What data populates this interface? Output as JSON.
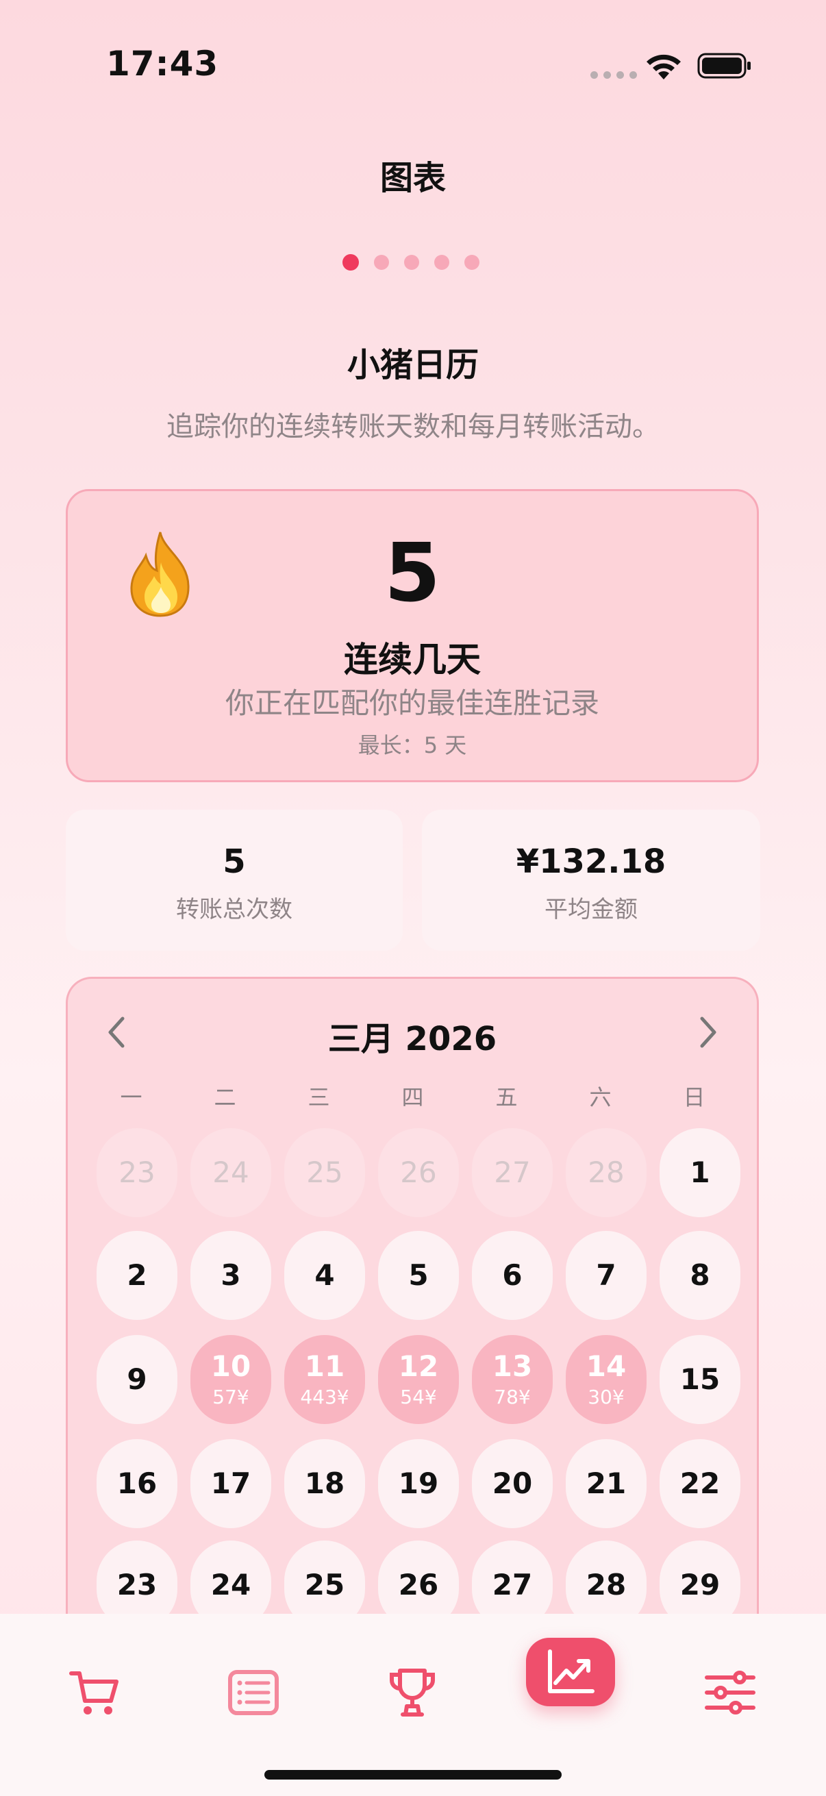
{
  "status": {
    "time": "17:43"
  },
  "nav": {
    "title": "图表"
  },
  "pager": {
    "count": 5,
    "active_index": 0
  },
  "section": {
    "title": "小猪日历",
    "subtitle": "追踪你的连续转账天数和每月转账活动。"
  },
  "streak": {
    "value": "5",
    "label": "连续几天",
    "message": "你正在匹配你的最佳连胜记录",
    "best": "最长：5 天",
    "icon": "flame-icon"
  },
  "stats": {
    "total_transfers": {
      "value": "5",
      "label": "转账总次数"
    },
    "average_amount": {
      "value": "¥132.18",
      "label": "平均金额"
    }
  },
  "calendar": {
    "month_title": "三月 2026",
    "weekdays": [
      "一",
      "二",
      "三",
      "四",
      "五",
      "六",
      "日"
    ],
    "days": [
      {
        "day": "23",
        "muted": true
      },
      {
        "day": "24",
        "muted": true
      },
      {
        "day": "25",
        "muted": true
      },
      {
        "day": "26",
        "muted": true
      },
      {
        "day": "27",
        "muted": true
      },
      {
        "day": "28",
        "muted": true
      },
      {
        "day": "1"
      },
      {
        "day": "2"
      },
      {
        "day": "3"
      },
      {
        "day": "4"
      },
      {
        "day": "5"
      },
      {
        "day": "6"
      },
      {
        "day": "7"
      },
      {
        "day": "8"
      },
      {
        "day": "9"
      },
      {
        "day": "10",
        "amount": "57¥"
      },
      {
        "day": "11",
        "amount": "443¥"
      },
      {
        "day": "12",
        "amount": "54¥"
      },
      {
        "day": "13",
        "amount": "78¥"
      },
      {
        "day": "14",
        "amount": "30¥"
      },
      {
        "day": "15"
      },
      {
        "day": "16"
      },
      {
        "day": "17"
      },
      {
        "day": "18"
      },
      {
        "day": "19"
      },
      {
        "day": "20"
      },
      {
        "day": "21"
      },
      {
        "day": "22"
      },
      {
        "day": "23"
      },
      {
        "day": "24"
      },
      {
        "day": "25"
      },
      {
        "day": "26"
      },
      {
        "day": "27"
      },
      {
        "day": "28"
      },
      {
        "day": "29"
      }
    ]
  },
  "tabs": [
    {
      "icon": "cart-icon"
    },
    {
      "icon": "list-icon"
    },
    {
      "icon": "trophy-icon"
    },
    {
      "icon": "chart-icon",
      "active": true
    },
    {
      "icon": "sliders-icon"
    }
  ],
  "colors": {
    "accent": "#ef4f6c",
    "active_day": "#f9b5c1",
    "card": "#fdd3d9"
  }
}
